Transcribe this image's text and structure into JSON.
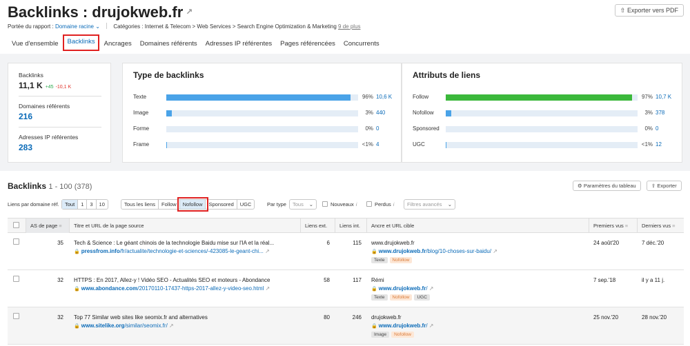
{
  "header": {
    "title_prefix": "Backlinks : ",
    "domain": "drujokweb.fr",
    "export_pdf": "Exporter vers PDF",
    "scope_label": "Portée du rapport :",
    "scope_value": "Domaine racine",
    "categories": "Catégories : Internet & Telecom > Web Services > Search Engine Optimization & Marketing",
    "categories_more": "9 de plus"
  },
  "tabs": [
    "Vue d'ensemble",
    "Backlinks",
    "Ancrages",
    "Domaines référents",
    "Adresses IP référentes",
    "Pages référencées",
    "Concurrents"
  ],
  "summary": {
    "backlinks_label": "Backlinks",
    "backlinks_value": "11,1 K",
    "backlinks_up": "+45",
    "backlinks_down": "-10,1 K",
    "domains_label": "Domaines référents",
    "domains_value": "216",
    "ips_label": "Adresses IP référentes",
    "ips_value": "283"
  },
  "types": {
    "title": "Type de backlinks",
    "rows": [
      {
        "label": "Texte",
        "pct": "96%",
        "count": "10,6 K",
        "fill": 96
      },
      {
        "label": "Image",
        "pct": "3%",
        "count": "440",
        "fill": 3
      },
      {
        "label": "Forme",
        "pct": "0%",
        "count": "0",
        "fill": 0
      },
      {
        "label": "Frame",
        "pct": "<1%",
        "count": "4",
        "fill": 0.4
      }
    ]
  },
  "attributes": {
    "title": "Attributs de liens",
    "rows": [
      {
        "label": "Follow",
        "pct": "97%",
        "count": "10,7 K",
        "fill": 97
      },
      {
        "label": "Nofollow",
        "pct": "3%",
        "count": "378",
        "fill": 3
      },
      {
        "label": "Sponsored",
        "pct": "0%",
        "count": "0",
        "fill": 0
      },
      {
        "label": "UGC",
        "pct": "<1%",
        "count": "12",
        "fill": 0.4
      }
    ]
  },
  "list": {
    "title": "Backlinks",
    "range": "1 - 100 (378)",
    "settings_btn": "Paramètres du tableau",
    "export_btn": "Exporter"
  },
  "filters": {
    "per_domain_label": "Liens par domaine réf.",
    "per_domain": [
      "Tout",
      "1",
      "3",
      "10"
    ],
    "link_types": [
      "Tous les liens",
      "Follow",
      "Nofollow",
      "Sponsored",
      "UGC"
    ],
    "by_type_label": "Par type",
    "by_type_value": "Tous",
    "new_label": "Nouveaux",
    "lost_label": "Perdus",
    "advanced": "Filtres avancés"
  },
  "columns": {
    "as": "AS de page",
    "title": "Titre et URL de la page source",
    "ext": "Liens ext.",
    "int": "Liens int.",
    "anchor": "Ancre et URL cible",
    "first": "Premiers vus",
    "last": "Derniers vus"
  },
  "rows": [
    {
      "as": "35",
      "title": "Tech & Science : Le géant chinois de la technologie Baidu mise sur l'IA et la réal...",
      "url_domain": "pressfrom.info",
      "url_path": "/fr/actualite/technologie-et-sciences/-423085-le-geant-chi...",
      "ext": "6",
      "int": "115",
      "anchor": "www.drujokweb.fr",
      "target_domain": "www.drujokweb.fr",
      "target_path": "/blog/10-choses-sur-baidu/",
      "tags": [
        "Texte",
        "Nofollow"
      ],
      "first": "24 août'20",
      "last": "7 déc.'20"
    },
    {
      "as": "32",
      "title": "HTTPS : En 2017, Allez-y ! Vidéo SEO - Actualités SEO et moteurs - Abondance",
      "url_domain": "www.abondance.com",
      "url_path": "/20170110-17437-https-2017-allez-y-video-seo.html",
      "ext": "58",
      "int": "117",
      "anchor": "Rémi",
      "target_domain": "www.drujokweb.fr",
      "target_path": "/",
      "tags": [
        "Texte",
        "Nofollow",
        "UGC"
      ],
      "first": "7 sep.'18",
      "last": "il y a 11 j."
    },
    {
      "as": "32",
      "title": "Top 77 Similar web sites like seomix.fr and alternatives",
      "url_domain": "www.sitelike.org",
      "url_path": "/similar/seomix.fr/",
      "ext": "80",
      "int": "246",
      "anchor": "drujokweb.fr",
      "target_domain": "www.drujokweb.fr",
      "target_path": "/",
      "tags": [
        "Image",
        "Nofollow"
      ],
      "first": "25 nov.'20",
      "last": "28 nov.'20"
    }
  ]
}
